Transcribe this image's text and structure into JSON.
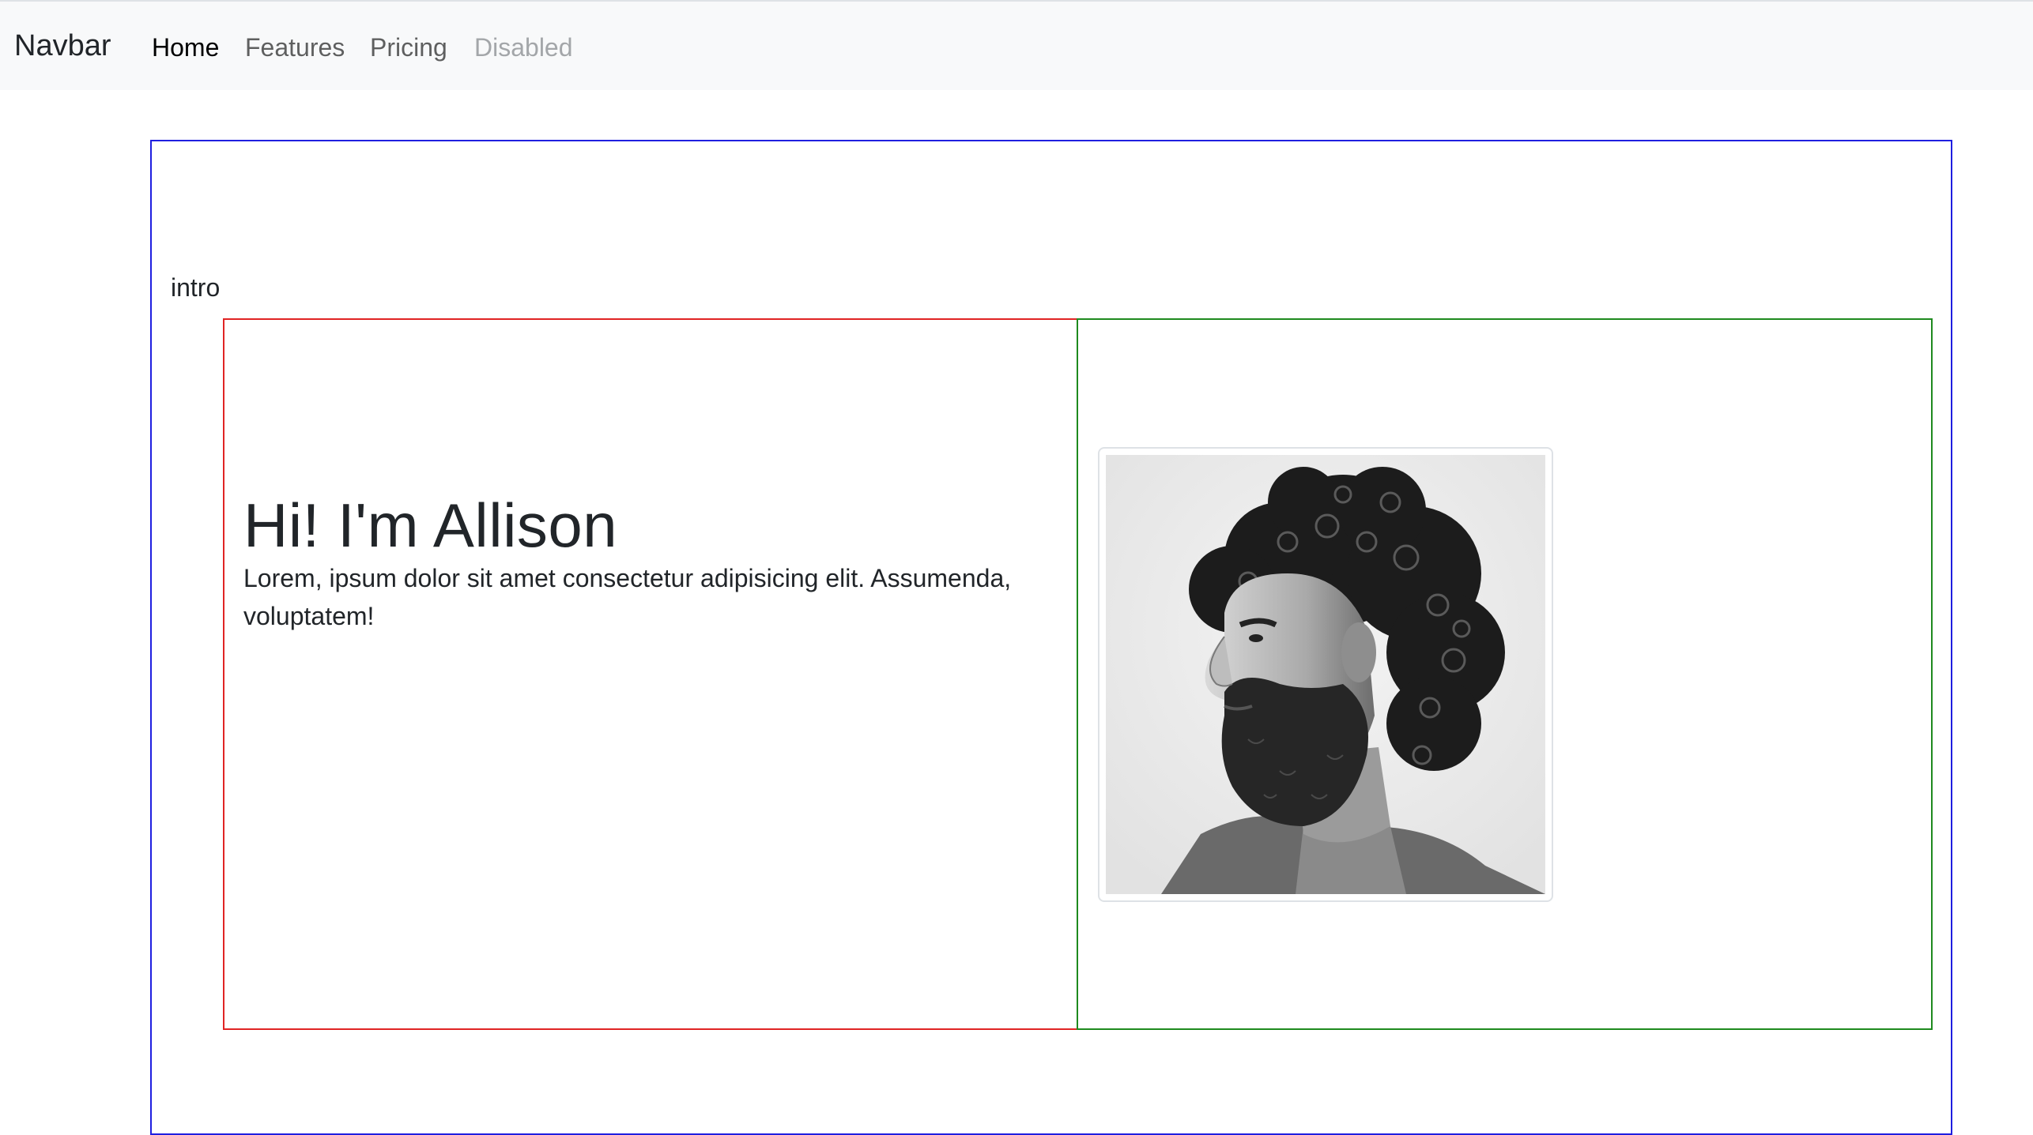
{
  "navbar": {
    "brand": "Navbar",
    "links": [
      {
        "label": "Home",
        "state": "active"
      },
      {
        "label": "Features",
        "state": "normal"
      },
      {
        "label": "Pricing",
        "state": "normal"
      },
      {
        "label": "Disabled",
        "state": "disabled"
      }
    ]
  },
  "section": {
    "label": "intro"
  },
  "hero": {
    "title": "Hi! I'm Allison",
    "text": "Lorem, ipsum dolor sit amet consectetur adipisicing elit. Assumenda, voluptatem!"
  },
  "image": {
    "subject": "black-and-white profile portrait of a bearded man with curly hair"
  },
  "colors": {
    "outer_border": "#1f1fe0",
    "left_border": "#e02424",
    "right_border": "#1e8a1e",
    "navbar_bg": "#f8f9fa"
  }
}
